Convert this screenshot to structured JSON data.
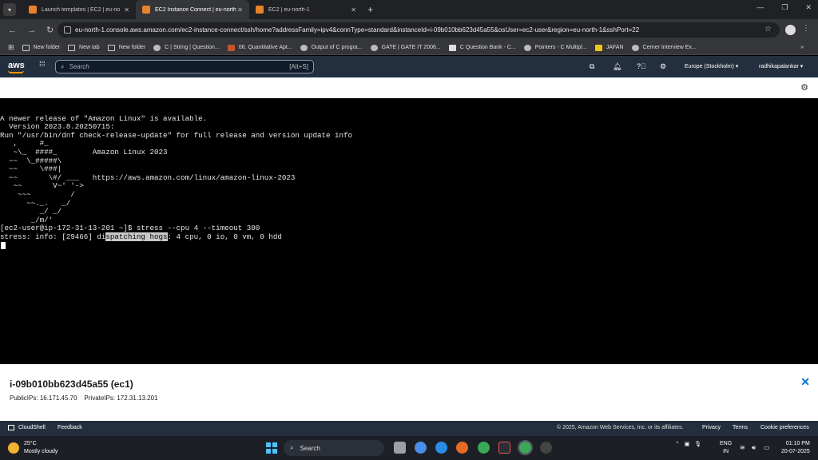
{
  "browser": {
    "tabs": [
      {
        "label": "Launch templates | EC2 | eu-no",
        "active": false
      },
      {
        "label": "EC2 Instance Connect | eu-north",
        "active": true
      },
      {
        "label": "EC2 | eu-north-1",
        "active": false
      }
    ],
    "url": "eu-north-1.console.aws.amazon.com/ec2-instance-connect/ssh/home?addressFamily=ipv4&connType=standard&instanceId=i-09b010bb623d45a55&osUser=ec2-user&region=eu-north-1&sshPort=22",
    "bookmarks": [
      {
        "label": "New folder",
        "icon": "folder-icon"
      },
      {
        "label": "New tab",
        "icon": "folder-icon"
      },
      {
        "label": "New folder",
        "icon": "folder-icon"
      },
      {
        "label": "C | String | Question...",
        "icon": "globe-icon"
      },
      {
        "label": "06. Quantitative Apt...",
        "icon": "site-icon"
      },
      {
        "label": "Output of C progra...",
        "icon": "globe-icon"
      },
      {
        "label": "GATE | GATE IT 2006...",
        "icon": "globe-icon"
      },
      {
        "label": "C Question Bank - C...",
        "icon": "site-icon"
      },
      {
        "label": "Pointers - C Multipl...",
        "icon": "globe-icon"
      },
      {
        "label": "JAFAN",
        "icon": "site-icon"
      },
      {
        "label": "Cerner Interview Ex...",
        "icon": "globe-icon"
      }
    ]
  },
  "aws": {
    "logo": "aws",
    "search_placeholder": "Search",
    "search_shortcut": "[Alt+S]",
    "region": "Europe (Stockholm) ▾",
    "account": "radhikapalankar ▾"
  },
  "terminal": {
    "lines": [
      "",
      "A newer release of \"Amazon Linux\" is available.",
      "  Version 2023.8.20250715:",
      "Run \"/usr/bin/dnf check-release-update\" for full release and version update info",
      "   ,     #_",
      "   ~\\_  ####_        Amazon Linux 2023",
      "  ~~  \\_#####\\",
      "  ~~     \\###|",
      "  ~~       \\#/ ___   https://aws.amazon.com/linux/amazon-linux-2023",
      "   ~~       V~' '->",
      "    ~~~         /",
      "      ~~._.   _/",
      "         _/ _/",
      "       _/m/'",
      "[ec2-user@ip-172-31-13-201 ~]$ stress --cpu 4 --timeout 300"
    ],
    "last_line_pre": "stress: info: [29466] di",
    "last_line_highlight": "spatching hogs",
    "last_line_post": ": 4 cpu, 0 io, 0 vm, 0 hdd"
  },
  "instance_panel": {
    "title": "i-09b010bb623d45a55 (ec1)",
    "public_ips_label": "PublicIPs:",
    "public_ips": "16.171.45.70",
    "private_ips_label": "PrivateIPs:",
    "private_ips": "172.31.13.201"
  },
  "footer": {
    "cloudshell": "CloudShell",
    "feedback": "Feedback",
    "copyright": "© 2025, Amazon Web Services, Inc. or its affiliates.",
    "privacy": "Privacy",
    "terms": "Terms",
    "cookie": "Cookie preferences"
  },
  "taskbar": {
    "temp": "25°C",
    "weather": "Mostly cloudy",
    "search": "Search",
    "lang1": "ENG",
    "lang2": "IN",
    "time": "01:10 PM",
    "date": "20-07-2025"
  }
}
